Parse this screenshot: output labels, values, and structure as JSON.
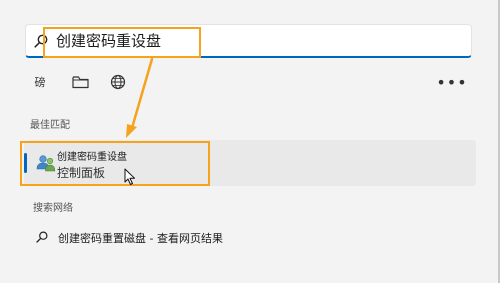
{
  "search": {
    "query": "创建密码重设盘"
  },
  "filters": {
    "apps_label": "磅"
  },
  "sections": {
    "best_match": "最佳匹配",
    "web": "搜索网络"
  },
  "best_result": {
    "title": "创建密码重设盘",
    "subtitle": "控制面板"
  },
  "web_result": {
    "text": "创建密码重置磁盘 - 查看网页结果"
  },
  "colors": {
    "accent": "#0067c0",
    "highlight": "#f5a21d",
    "background": "#f3f3f3"
  },
  "icons": {
    "search": "search-icon",
    "folder": "folder-icon",
    "globe": "globe-icon",
    "more": "more-icon",
    "users": "users-icon",
    "cursor": "cursor-icon",
    "arrow": "annotation-arrow"
  }
}
